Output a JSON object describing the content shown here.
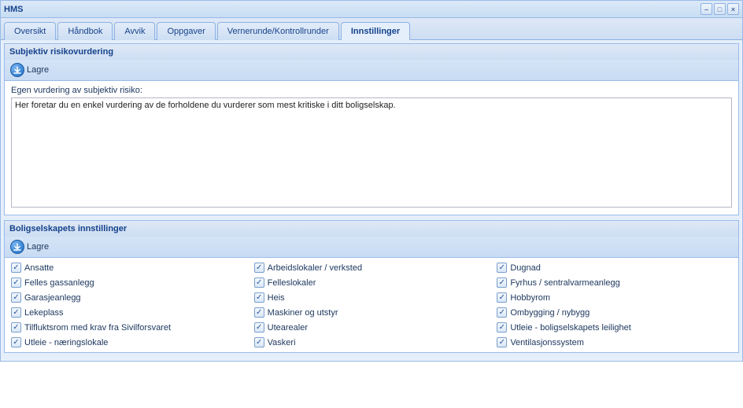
{
  "window": {
    "title": "HMS"
  },
  "tabs": [
    {
      "label": "Oversikt",
      "active": false
    },
    {
      "label": "Håndbok",
      "active": false
    },
    {
      "label": "Avvik",
      "active": false
    },
    {
      "label": "Oppgaver",
      "active": false
    },
    {
      "label": "Vernerunde/Kontrollrunder",
      "active": false
    },
    {
      "label": "Innstillinger",
      "active": true
    }
  ],
  "panel1": {
    "title": "Subjektiv risikovurdering",
    "save": "Lagre",
    "field_label": "Egen vurdering av subjektiv risiko:",
    "textarea_value": "Her foretar du en enkel vurdering av de forholdene du vurderer som mest kritiske i ditt boligselskap."
  },
  "panel2": {
    "title": "Boligselskapets innstillinger",
    "save": "Lagre",
    "checkboxes": [
      {
        "label": "Ansatte",
        "checked": true
      },
      {
        "label": "Arbeidslokaler / verksted",
        "checked": true
      },
      {
        "label": "Dugnad",
        "checked": true
      },
      {
        "label": "Felles gassanlegg",
        "checked": true
      },
      {
        "label": "Felleslokaler",
        "checked": true
      },
      {
        "label": "Fyrhus / sentralvarmeanlegg",
        "checked": true
      },
      {
        "label": "Garasjeanlegg",
        "checked": true
      },
      {
        "label": "Heis",
        "checked": true
      },
      {
        "label": "Hobbyrom",
        "checked": true
      },
      {
        "label": "Lekeplass",
        "checked": true
      },
      {
        "label": "Maskiner og utstyr",
        "checked": true
      },
      {
        "label": "Ombygging / nybygg",
        "checked": true
      },
      {
        "label": "Tilfluktsrom med krav fra Sivilforsvaret",
        "checked": true
      },
      {
        "label": "Utearealer",
        "checked": true
      },
      {
        "label": "Utleie - boligselskapets leilighet",
        "checked": true
      },
      {
        "label": "Utleie - næringslokale",
        "checked": true
      },
      {
        "label": "Vaskeri",
        "checked": true
      },
      {
        "label": "Ventilasjonssystem",
        "checked": true
      }
    ]
  }
}
